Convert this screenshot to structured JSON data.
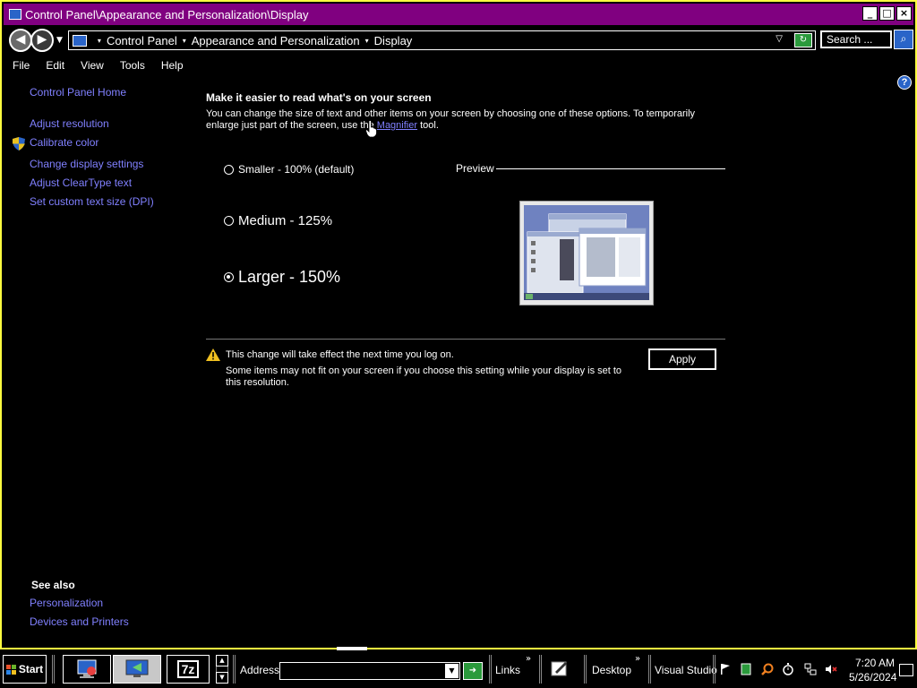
{
  "window": {
    "title": "Control Panel\\Appearance and Personalization\\Display",
    "min_glyph": "_",
    "max_glyph": "□",
    "close_glyph": "×"
  },
  "addressbar": {
    "crumbs": [
      "Control Panel",
      "Appearance and Personalization",
      "Display"
    ],
    "search_placeholder": "Search ..."
  },
  "menu": [
    "File",
    "Edit",
    "View",
    "Tools",
    "Help"
  ],
  "sidebar": {
    "home": "Control Panel Home",
    "links": [
      "Adjust resolution",
      "Calibrate color",
      "Change display settings",
      "Adjust ClearType text",
      "Set custom text size (DPI)"
    ],
    "see_also_title": "See also",
    "see_also": [
      "Personalization",
      "Devices and Printers"
    ]
  },
  "main": {
    "heading": "Make it easier to read what's on your screen",
    "desc_before": "You can change the size of text and other items on your screen by choosing one of these options. To temporarily enlarge just part of the screen, use the ",
    "desc_link": "Magnifier",
    "desc_after": " tool.",
    "options": [
      {
        "label": "Smaller - 100% (default)",
        "checked": false
      },
      {
        "label": "Medium - 125%",
        "checked": false
      },
      {
        "label": "Larger - 150%",
        "checked": true
      }
    ],
    "preview_label": "Preview",
    "warning_line1": "This change will take effect the next time you log on.",
    "warning_line2": "Some items may not fit on your screen if you choose this setting while your display is set to this resolution.",
    "apply_label": "Apply"
  },
  "taskbar": {
    "start_label": "Start",
    "address_label": "Address",
    "links_label": "Links",
    "desktop_label": "Desktop",
    "vs_label": "Visual Studio",
    "sevenzip_label": "7z",
    "time": "7:20 AM",
    "date": "5/26/2024"
  },
  "colors": {
    "title_bar": "#800080",
    "window_border": "#ffff40",
    "link": "#8080ff",
    "background": "#000000"
  }
}
